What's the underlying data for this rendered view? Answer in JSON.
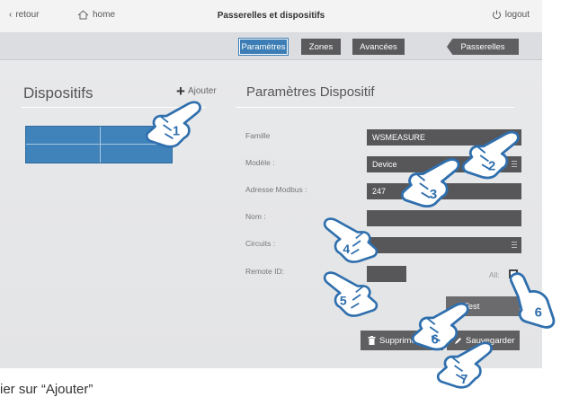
{
  "topbar": {
    "back_label": "retour",
    "home_label": "home",
    "title": "Passerelles et dispositifs",
    "logout_label": "logout"
  },
  "tabs": {
    "params": "Paramètres",
    "zones": "Zones",
    "advanced": "Avancées",
    "gateways": "Passerelles"
  },
  "left": {
    "title": "Dispositifs",
    "add_label": "Ajouter"
  },
  "right": {
    "title": "Paramètres Dispositif",
    "family_label": "Famille",
    "family_value": "WSMEASURE",
    "model_label": "Modèle :",
    "model_value": "Device",
    "modbus_label": "Adresse Modbus :",
    "modbus_value": "247",
    "name_label": "Nom :",
    "name_value": "",
    "circuits_label": "Circuits :",
    "circuits_value": "",
    "remote_label": "Remote ID:",
    "all_label": "All:",
    "test_label": "Test",
    "delete_label": "Supprimer",
    "save_label": "Sauvegarder"
  },
  "callouts": [
    "1",
    "2",
    "3",
    "4",
    "5",
    "6",
    "6",
    "7"
  ],
  "caption": "ier sur “Ajouter”",
  "colors": {
    "accent": "#3b7db4",
    "dark_field": "#575759",
    "callout_blue": "#2f6fad"
  }
}
